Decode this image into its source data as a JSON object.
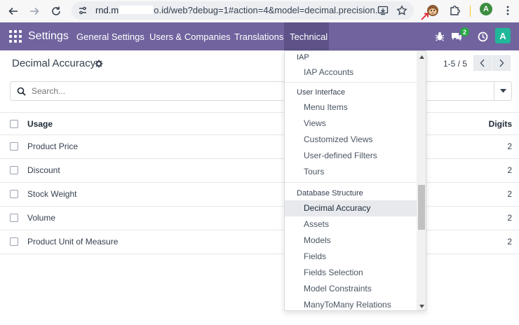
{
  "browser": {
    "url_prefix": "rnd.m",
    "url_suffix": "o.id/web?debug=1#action=4&model=decimal.precision..."
  },
  "navbar": {
    "app_title": "Settings",
    "menu": [
      {
        "label": "General Settings"
      },
      {
        "label": "Users & Companies"
      },
      {
        "label": "Translations"
      },
      {
        "label": "Technical"
      }
    ],
    "messages_count": "2",
    "avatar_letter": "A",
    "colors": {
      "bar": "#71639e",
      "active": "#5e5288",
      "avatar": "#21b799",
      "badge": "#28a745"
    }
  },
  "control_panel": {
    "breadcrumb": "Decimal Accuracy",
    "pager": "1-5 / 5",
    "search_placeholder": "Search..."
  },
  "list": {
    "columns": {
      "usage": "Usage",
      "digits": "Digits"
    },
    "rows": [
      {
        "usage": "Product Price",
        "digits": "2"
      },
      {
        "usage": "Discount",
        "digits": "2"
      },
      {
        "usage": "Stock Weight",
        "digits": "2"
      },
      {
        "usage": "Volume",
        "digits": "2"
      },
      {
        "usage": "Product Unit of Measure",
        "digits": "2"
      }
    ]
  },
  "dropdown": {
    "sections": [
      {
        "header": "IAP",
        "items": [
          "IAP Accounts"
        ]
      },
      {
        "header": "User Interface",
        "items": [
          "Menu Items",
          "Views",
          "Customized Views",
          "User-defined Filters",
          "Tours"
        ]
      },
      {
        "header": "Database Structure",
        "items": [
          "Decimal Accuracy",
          "Assets",
          "Models",
          "Fields",
          "Fields Selection",
          "Model Constraints",
          "ManyToMany Relations"
        ]
      }
    ],
    "active_item": "Decimal Accuracy"
  }
}
